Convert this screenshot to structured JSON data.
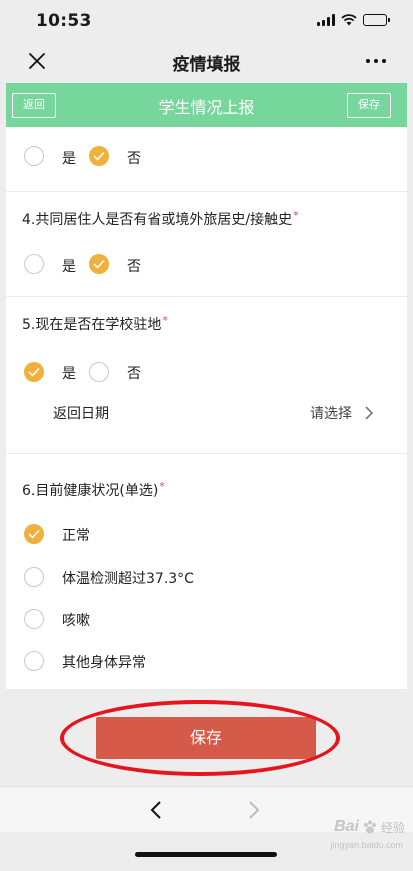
{
  "status_bar": {
    "time": "10:53"
  },
  "nav": {
    "title": "疫情填报"
  },
  "header": {
    "back_label": "返回",
    "title": "学生情况上报",
    "save_label": "保存"
  },
  "questions": {
    "q3": {
      "options": [
        {
          "label": "是",
          "checked": false
        },
        {
          "label": "否",
          "checked": true
        }
      ]
    },
    "q4": {
      "title": "4.共同居住人是否有省或境外旅居史/接触史",
      "required": "*",
      "options": [
        {
          "label": "是",
          "checked": false
        },
        {
          "label": "否",
          "checked": true
        }
      ]
    },
    "q5": {
      "title": "5.现在是否在学校驻地",
      "required": "*",
      "options": [
        {
          "label": "是",
          "checked": true
        },
        {
          "label": "否",
          "checked": false
        }
      ],
      "return_date": {
        "label": "返回日期",
        "value": "请选择"
      }
    },
    "q6": {
      "title": "6.目前健康状况(单选)",
      "required": "*",
      "options": [
        {
          "label": "正常",
          "checked": true
        },
        {
          "label": "体温检测超过37.3°C",
          "checked": false
        },
        {
          "label": "咳嗽",
          "checked": false
        },
        {
          "label": "其他身体异常",
          "checked": false
        }
      ]
    }
  },
  "footer": {
    "save_label": "保存"
  },
  "watermark": {
    "logo": "Bai",
    "text": "经验",
    "sub": "jingyan.baidu.com"
  },
  "colors": {
    "accent_green": "#76d69b",
    "check_orange": "#f0b03c",
    "save_red": "#d65a4a",
    "highlight_red": "#e6151d"
  }
}
